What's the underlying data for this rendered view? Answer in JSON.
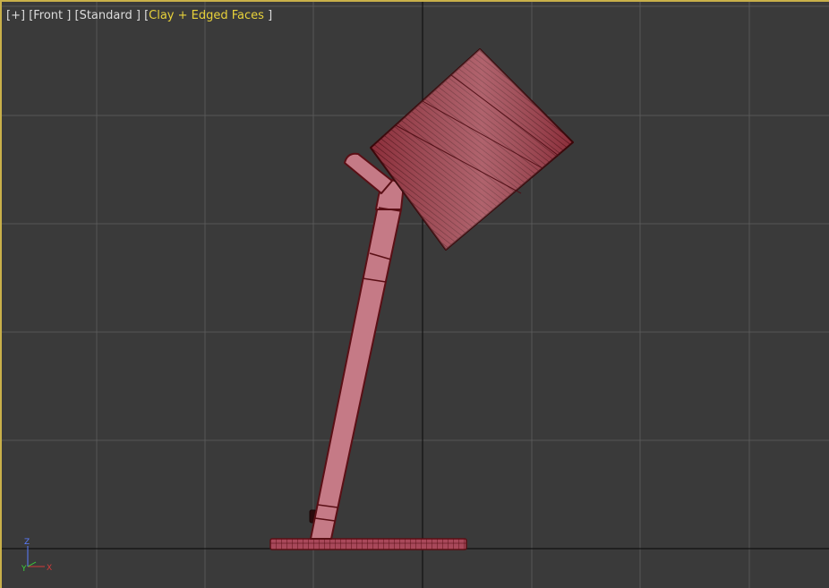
{
  "viewport": {
    "labels": [
      {
        "text": "[+]"
      },
      {
        "text": "[Front ]"
      },
      {
        "text": "[Standard ]"
      },
      {
        "text": "Clay + Edged Faces"
      }
    ],
    "active_label_prefix": "[",
    "active_label_suffix": "]",
    "accent_color": "#e8d23a",
    "border_color": "#c9b04a",
    "grid_color": "#575757",
    "axis_color": "#111111",
    "background_color": "#3a3a3a"
  },
  "model": {
    "mesh_color": "#c57a86",
    "wire_color": "#5a0f15"
  },
  "axis_gizmo": {
    "z": "Z",
    "y": "Y",
    "x": "X"
  }
}
